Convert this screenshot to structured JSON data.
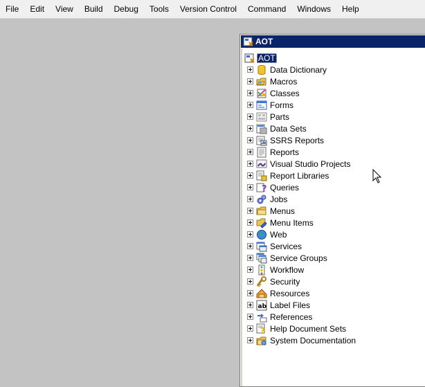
{
  "menubar": {
    "items": [
      "File",
      "Edit",
      "View",
      "Build",
      "Debug",
      "Tools",
      "Version Control",
      "Command",
      "Windows",
      "Help"
    ]
  },
  "aot": {
    "title": "AOT",
    "root_label": "AOT",
    "nodes": [
      {
        "label": "Data Dictionary",
        "icon": "data-dictionary-icon"
      },
      {
        "label": "Macros",
        "icon": "macros-icon"
      },
      {
        "label": "Classes",
        "icon": "classes-icon"
      },
      {
        "label": "Forms",
        "icon": "forms-icon"
      },
      {
        "label": "Parts",
        "icon": "parts-icon"
      },
      {
        "label": "Data Sets",
        "icon": "data-sets-icon"
      },
      {
        "label": "SSRS Reports",
        "icon": "ssrs-reports-icon"
      },
      {
        "label": "Reports",
        "icon": "reports-icon"
      },
      {
        "label": "Visual Studio Projects",
        "icon": "visual-studio-projects-icon"
      },
      {
        "label": "Report Libraries",
        "icon": "report-libraries-icon"
      },
      {
        "label": "Queries",
        "icon": "queries-icon"
      },
      {
        "label": "Jobs",
        "icon": "jobs-icon"
      },
      {
        "label": "Menus",
        "icon": "menus-icon"
      },
      {
        "label": "Menu Items",
        "icon": "menu-items-icon"
      },
      {
        "label": "Web",
        "icon": "web-icon"
      },
      {
        "label": "Services",
        "icon": "services-icon"
      },
      {
        "label": "Service Groups",
        "icon": "service-groups-icon"
      },
      {
        "label": "Workflow",
        "icon": "workflow-icon"
      },
      {
        "label": "Security",
        "icon": "security-icon"
      },
      {
        "label": "Resources",
        "icon": "resources-icon"
      },
      {
        "label": "Label Files",
        "icon": "label-files-icon"
      },
      {
        "label": "References",
        "icon": "references-icon"
      },
      {
        "label": "Help Document Sets",
        "icon": "help-document-sets-icon"
      },
      {
        "label": "System Documentation",
        "icon": "system-documentation-icon"
      }
    ]
  },
  "colors": {
    "titlebar": "#0a246a",
    "workspace": "#c4c3c4",
    "menubar": "#f0f0f0"
  }
}
